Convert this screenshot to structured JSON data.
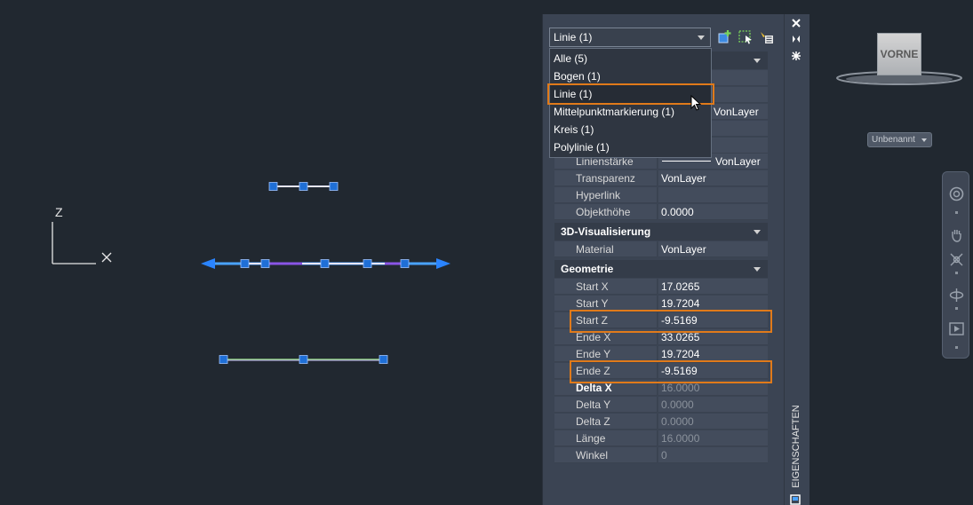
{
  "dropdown": {
    "selected": "Linie (1)",
    "options": [
      "Alle (5)",
      "Bogen (1)",
      "Linie (1)",
      "Mittelpunktmarkierung (1)",
      "Kreis (1)",
      "Polylinie (1)"
    ]
  },
  "partial_rows": {
    "row1_value": "VonLayer",
    "linienstaerke_label": "Linienstärke",
    "linienstaerke_value": "VonLayer",
    "transparenz_label": "Transparenz",
    "transparenz_value": "VonLayer",
    "hyperlink_label": "Hyperlink",
    "hyperlink_value": "",
    "objekthoehe_label": "Objekthöhe",
    "objekthoehe_value": "0.0000"
  },
  "sections": {
    "visualisierung": "3D-Visualisierung",
    "geometrie": "Geometrie"
  },
  "visualisierung_rows": [
    {
      "label": "Material",
      "value": "VonLayer"
    }
  ],
  "geometry_rows": [
    {
      "label": "Start X",
      "value": "17.0265"
    },
    {
      "label": "Start Y",
      "value": "19.7204"
    },
    {
      "label": "Start Z",
      "value": "-9.5169"
    },
    {
      "label": "Ende X",
      "value": "33.0265"
    },
    {
      "label": "Ende Y",
      "value": "19.7204"
    },
    {
      "label": "Ende Z",
      "value": "-9.5169"
    },
    {
      "label": "Delta X",
      "value": "16.0000"
    },
    {
      "label": "Delta Y",
      "value": "0.0000"
    },
    {
      "label": "Delta Z",
      "value": "0.0000"
    },
    {
      "label": "Länge",
      "value": "16.0000"
    },
    {
      "label": "Winkel",
      "value": "0"
    }
  ],
  "palette_title": "EIGENSCHAFTEN",
  "viewcube_label": "VORNE",
  "ucs_label": "Unbenannt",
  "ucs_axes": {
    "z": "Z",
    "x": "X"
  },
  "colors": {
    "background": "#212830",
    "panel": "#3b4453",
    "highlight": "#e07a1a",
    "grip": "#1f6fd6",
    "line": "#4aa3ff"
  }
}
